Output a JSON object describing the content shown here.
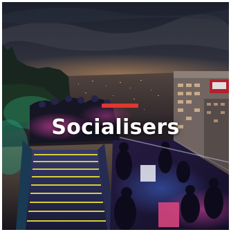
{
  "card": {
    "title": "Socialisers",
    "image_icon": "rooftop-bar-photo",
    "accent_color": "#e0382f"
  }
}
